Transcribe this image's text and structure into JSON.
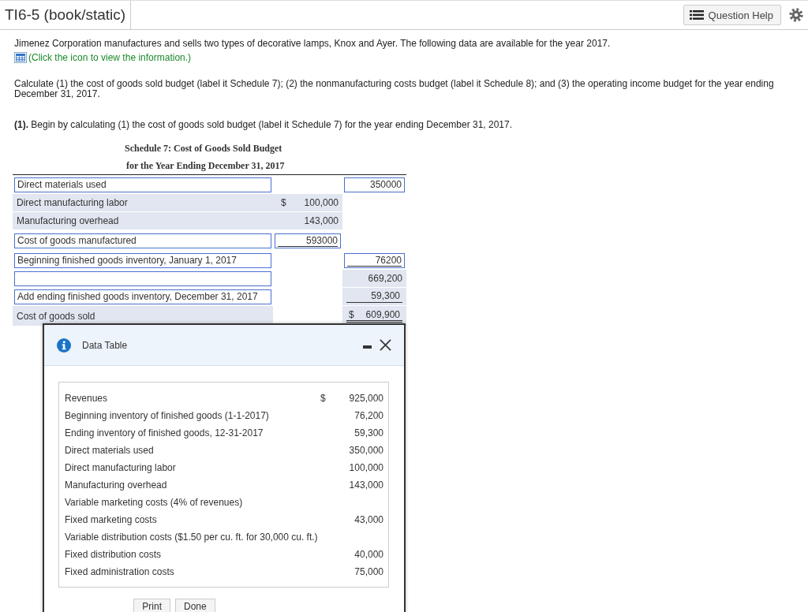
{
  "header": {
    "title": "TI6-5 (book/static)",
    "help_button": "Question Help"
  },
  "intro": "Jimenez Corporation manufactures and sells two types of decorative lamps, Knox and Ayer. The following data are available for the year 2017.",
  "info_link": "(Click the icon to view the information.)",
  "task": "Calculate (1) the cost of goods sold budget (label it Schedule 7); (2) the nonmanufacturing costs budget (label it Schedule 8); and (3) the operating income budget for the year ending December 31, 2017.",
  "step": "**(1).** Begin by calculating (1) the cost of goods sold budget (label it Schedule 7) for the year ending December 31, 2017.",
  "schedule": {
    "title": "Schedule 7: Cost of Goods Sold Budget",
    "subtitle": "for the Year Ending December 31, 2017",
    "rows": [
      {
        "label": {
          "kind": "input",
          "value": "Direct materials used"
        },
        "right": {
          "kind": "input",
          "value": "350000"
        }
      },
      {
        "label": {
          "kind": "text",
          "value": "Direct manufacturing labor",
          "shaded": true
        },
        "mid": {
          "kind": "text",
          "currency": "$",
          "value": "100,000",
          "shaded": true
        }
      },
      {
        "label": {
          "kind": "text",
          "value": "Manufacturing overhead",
          "shaded": true
        },
        "mid": {
          "kind": "text",
          "value": "143,000",
          "shaded": true
        }
      },
      {
        "label": {
          "kind": "input",
          "value": "Cost of goods manufactured"
        },
        "mid": {
          "kind": "input",
          "value": "593000",
          "underlined": true
        }
      },
      {
        "label": {
          "kind": "input",
          "value": "Beginning finished goods inventory, January 1, 2017"
        },
        "right": {
          "kind": "input",
          "value": "76200",
          "underlined": true
        }
      },
      {
        "label": {
          "kind": "input"
        },
        "right": {
          "kind": "text",
          "value": "669,200",
          "shaded": true
        }
      },
      {
        "label": {
          "kind": "input",
          "value": "Add ending finished goods inventory, December 31, 2017"
        },
        "right": {
          "kind": "text",
          "value": "59,300",
          "shaded": true,
          "underlined": true
        }
      },
      {
        "label": {
          "kind": "text",
          "value": "Cost of goods sold",
          "shaded": true
        },
        "right": {
          "kind": "text",
          "currency": "$",
          "value": "609,900",
          "shaded": true,
          "double_underlined": true
        }
      }
    ]
  },
  "dialog": {
    "title": "Data Table",
    "rows": [
      {
        "label": "Revenues",
        "currency": "$",
        "value": "925,000"
      },
      {
        "label": "Beginning inventory of finished goods (1-1-2017)",
        "value": "76,200"
      },
      {
        "label": "Ending inventory of finished goods, 12-31-2017",
        "value": "59,300"
      },
      {
        "label": "Direct materials used",
        "value": "350,000"
      },
      {
        "label": "Direct manufacturing labor",
        "value": "100,000"
      },
      {
        "label": "Manufacturing overhead",
        "value": "143,000"
      },
      {
        "label": "Variable marketing costs (4% of revenues)"
      },
      {
        "label": "Fixed marketing costs",
        "value": "43,000"
      },
      {
        "label": "Variable distribution costs ($1.50 per cu. ft. for 30,000 cu. ft.)"
      },
      {
        "label": "Fixed distribution costs",
        "value": "40,000"
      },
      {
        "label": "Fixed administration costs",
        "value": "75,000"
      }
    ],
    "buttons": [
      "Print",
      "Done"
    ]
  }
}
